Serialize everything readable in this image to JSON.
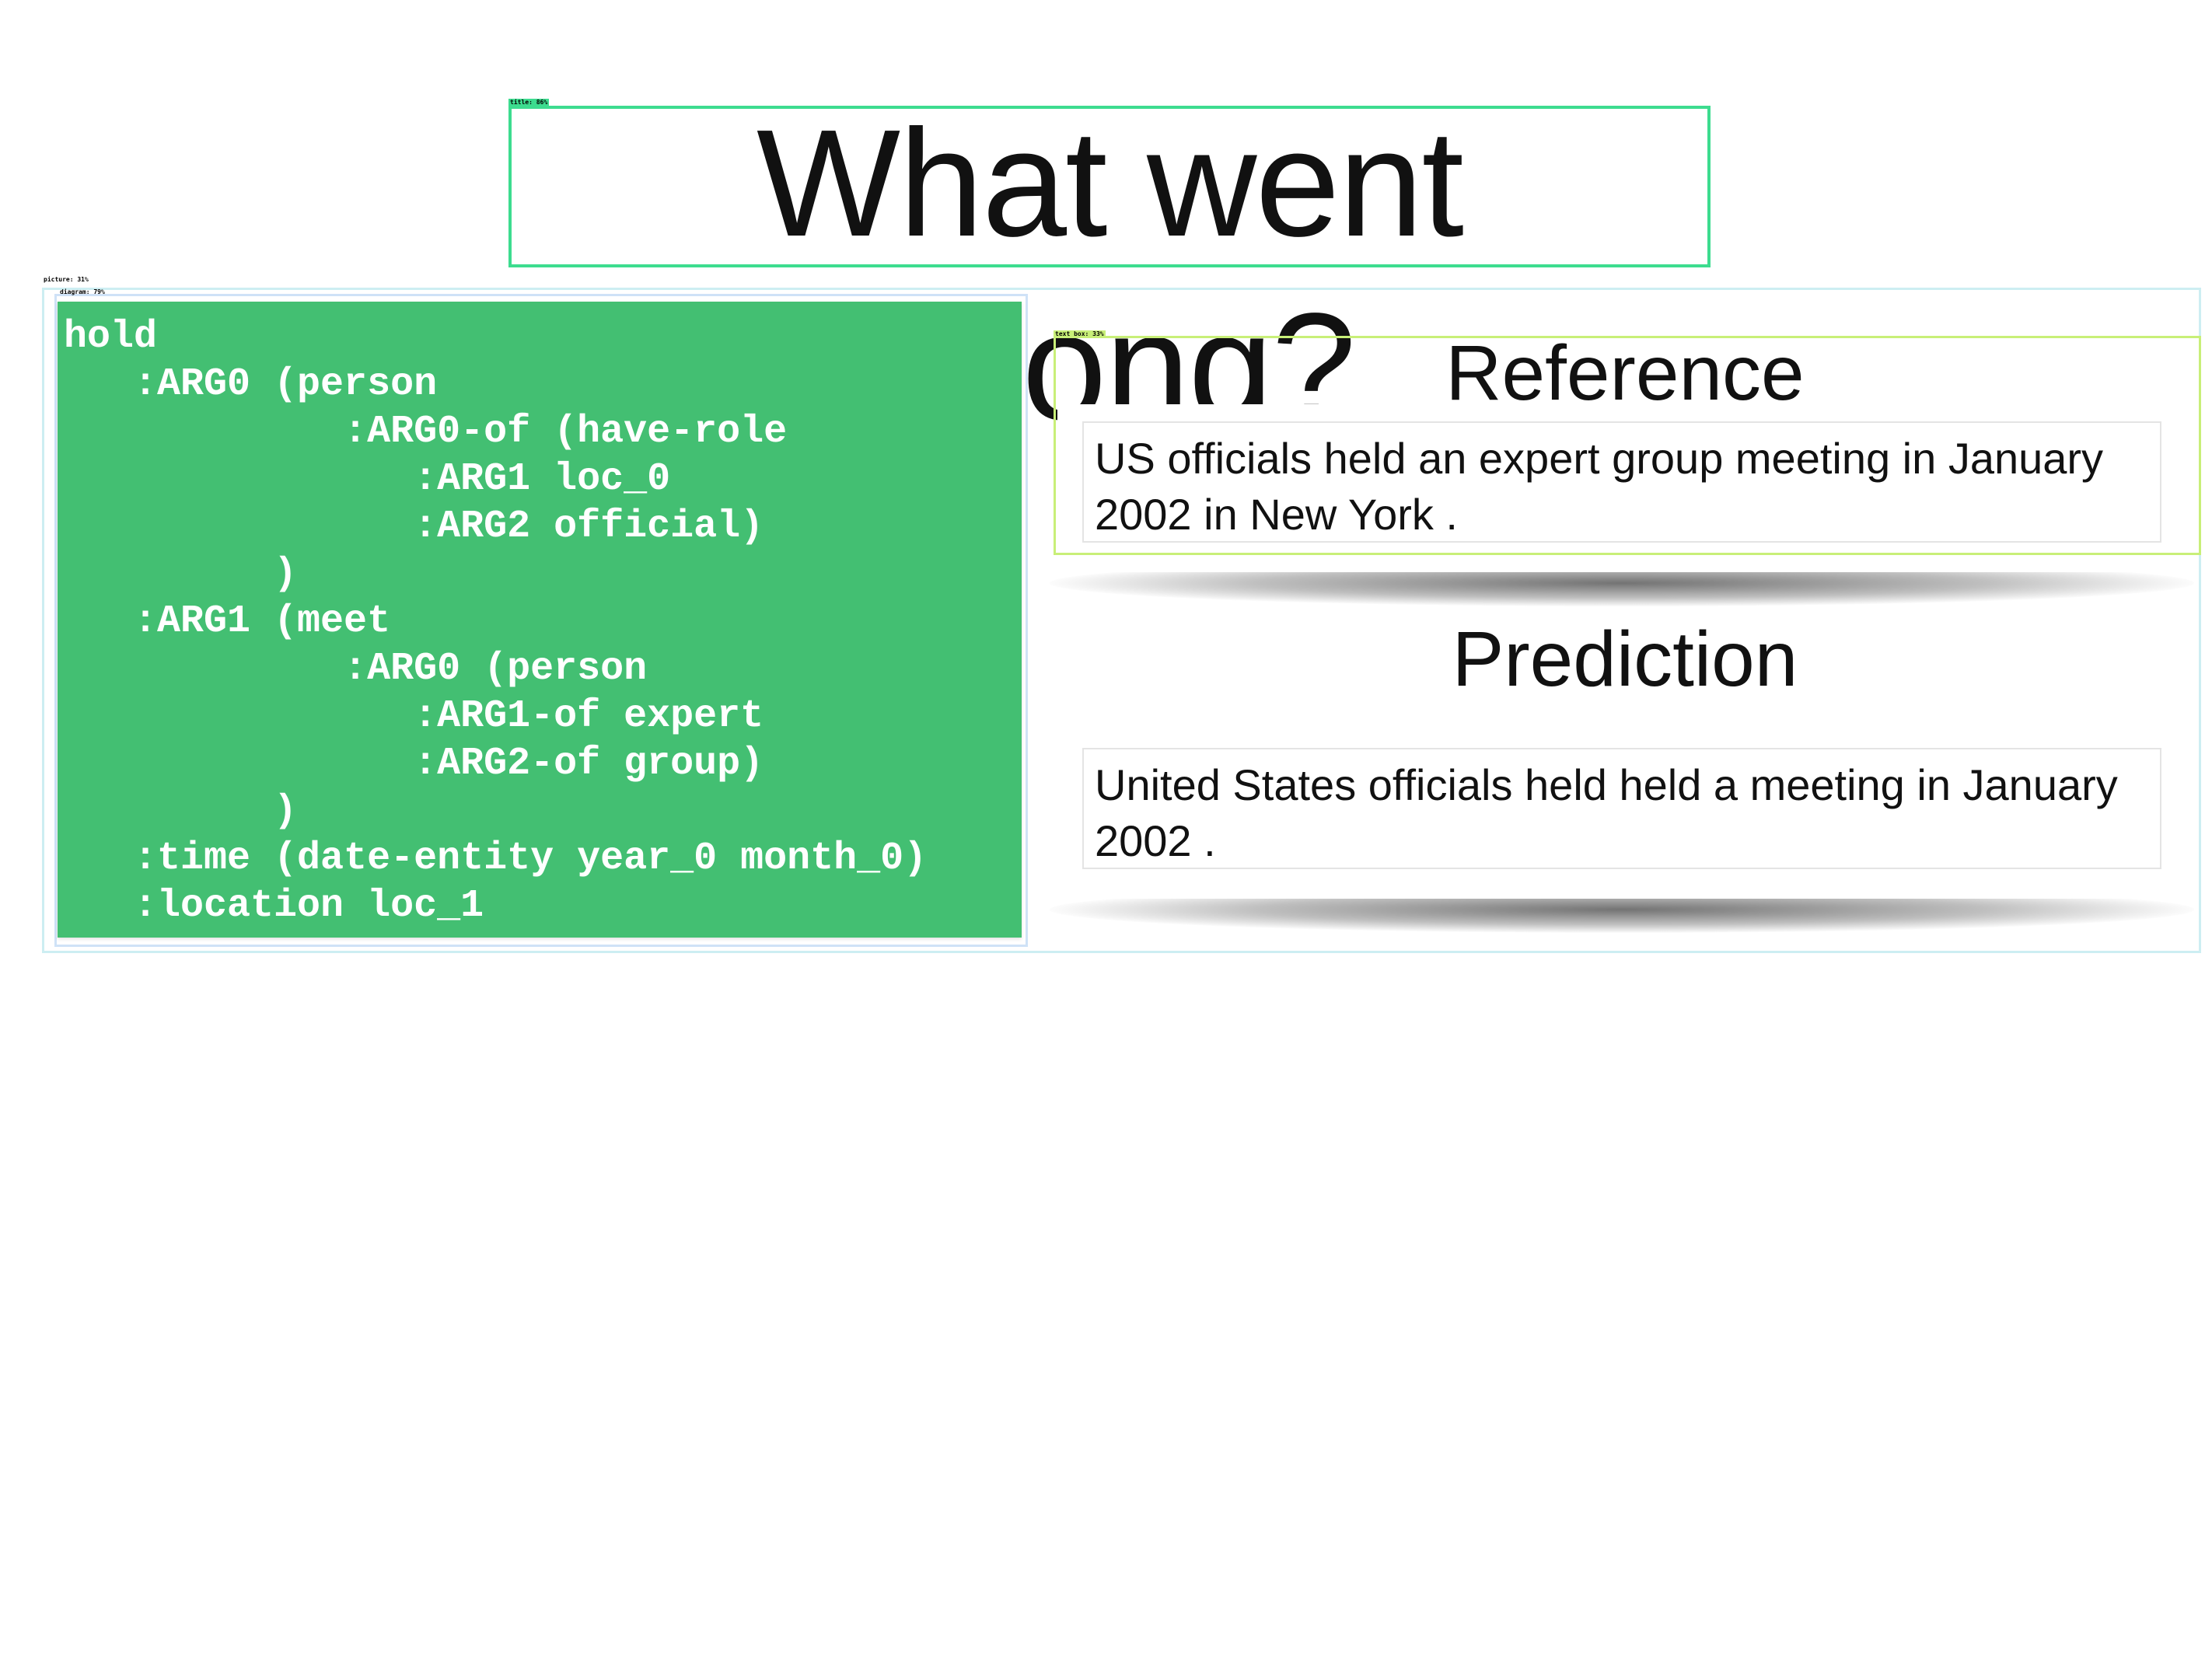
{
  "slide": {
    "title": "What went wrong?"
  },
  "detections": {
    "title_tag": "title: 86%",
    "picture_tag": "picture: 31%",
    "diagram_tag": "diagram: 79%",
    "text_box_tag": "text box: 33%"
  },
  "amr_graph": {
    "lines": [
      "hold",
      "   :ARG0 (person",
      "            :ARG0-of (have-role",
      "               :ARG1 loc_0",
      "               :ARG2 official)",
      "         )",
      "   :ARG1 (meet",
      "            :ARG0 (person",
      "               :ARG1-of expert",
      "               :ARG2-of group)",
      "         )",
      "   :time (date-entity year_0 month_0)",
      "   :location loc_1"
    ]
  },
  "reference": {
    "heading": "Reference",
    "text": "US officials held an expert group meeting in January 2002 in New York ."
  },
  "prediction": {
    "heading": "Prediction",
    "text": "United States officials held held a meeting in January 2002 ."
  },
  "colors": {
    "code_panel_bg": "#43bf72",
    "title_box": "#3ddc8f",
    "text_box": "#c8ef78"
  }
}
